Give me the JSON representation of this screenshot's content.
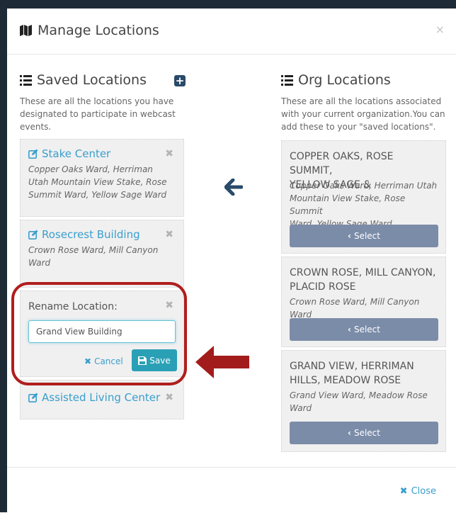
{
  "modal": {
    "title": "Manage Locations",
    "close_glyph": "×"
  },
  "saved": {
    "heading": "Saved Locations",
    "description_lines": [
      "These are all the locations you have",
      "designated to participate in webcast",
      "events."
    ],
    "add_glyph": "+",
    "items": [
      {
        "name": "Stake Center",
        "wards_lines": [
          "Copper Oaks Ward, Herriman",
          "Utah Mountain View Stake, Rose",
          "Summit Ward, Yellow Sage Ward"
        ]
      },
      {
        "name": "Rosecrest Building",
        "wards_lines": [
          "Crown Rose Ward, Mill Canyon",
          "Ward"
        ]
      },
      {
        "name": "Assisted Living Center",
        "wards_lines": []
      }
    ],
    "rename": {
      "label": "Rename Location:",
      "value": "Grand View Building",
      "cancel_label": "Cancel",
      "save_label": "Save"
    }
  },
  "org": {
    "heading": "Org Locations",
    "description_lines": [
      "These are all the locations associated",
      "with your current organization.You can",
      "add these to your \"saved locations\"."
    ],
    "items": [
      {
        "name_lines": [
          "COPPER OAKS, ROSE SUMMIT,",
          "YELLOW SAGE &"
        ],
        "wards_lines": [
          "Copper Oaks Ward, Herriman Utah",
          "Mountain View Stake, Rose Summit",
          "Ward, Yellow Sage Ward"
        ],
        "select_label": "Select"
      },
      {
        "name_lines": [
          "CROWN ROSE, MILL CANYON,",
          "PLACID ROSE"
        ],
        "wards_lines": [
          "Crown Rose Ward, Mill Canyon Ward"
        ],
        "select_label": "Select"
      },
      {
        "name_lines": [
          "GRAND VIEW, HERRIMAN",
          "HILLS, MEADOW ROSE"
        ],
        "wards_lines": [
          "Grand View Ward, Meadow Rose",
          "Ward"
        ],
        "select_label": "Select"
      }
    ]
  },
  "footer": {
    "close_label": "Close",
    "close_glyph": "✖"
  },
  "icons": {
    "title": "map-icon",
    "list": "list-icon",
    "edit": "edit-icon",
    "save": "floppy-icon",
    "arrow": "arrow-left-icon",
    "callout_arrow": "callout-arrow-icon"
  },
  "colors": {
    "link": "#3a9ecc",
    "select_button": "#7b8ca8",
    "save_button": "#2aa0b6",
    "callout": "#b01e1e",
    "arrow": "#2a4a6a"
  }
}
